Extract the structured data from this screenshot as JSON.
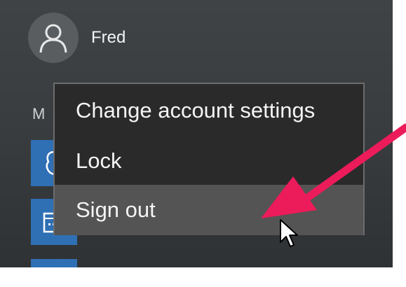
{
  "account": {
    "name": "Fred",
    "avatar_icon": "user-avatar-icon"
  },
  "start_menu": {
    "section_letter": "M",
    "tiles": [
      {
        "icon": "app-tile-icon"
      },
      {
        "icon": "calendar-tile-icon"
      },
      {
        "icon": "app-tile-icon"
      }
    ]
  },
  "account_menu": {
    "items": [
      {
        "label": "Change account settings",
        "highlighted": false
      },
      {
        "label": "Lock",
        "highlighted": false
      },
      {
        "label": "Sign out",
        "highlighted": true
      }
    ]
  },
  "annotation": {
    "arrow_icon": "pointer-arrow-icon",
    "arrow_color": "#ec1b5a"
  },
  "colors": {
    "menu_background": "#2a2a2b",
    "highlight": "#545454",
    "tile": "#2f6fb4"
  }
}
